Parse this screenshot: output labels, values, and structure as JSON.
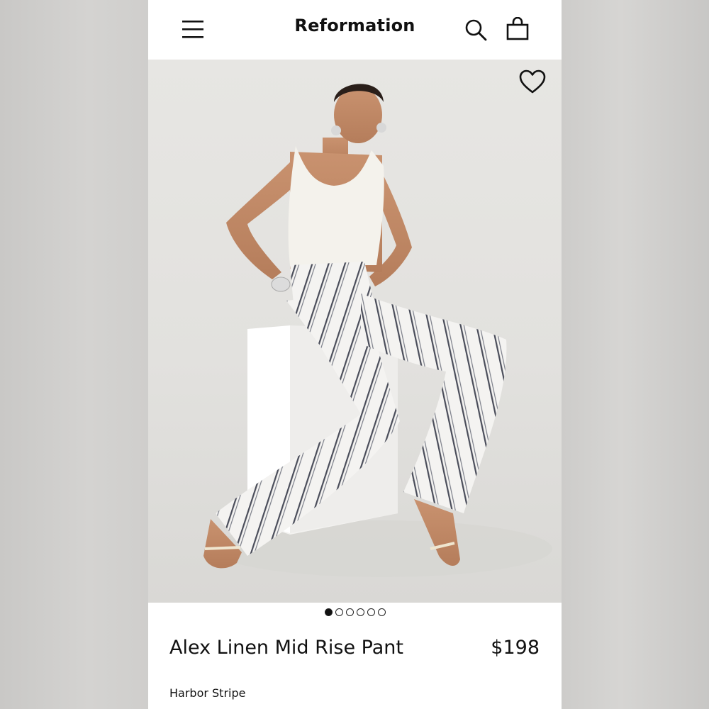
{
  "header": {
    "brand": "Reformation",
    "menu_icon": "hamburger-menu-icon",
    "search_icon": "search-icon",
    "bag_icon": "shopping-bag-icon"
  },
  "hero": {
    "wishlist_icon": "heart-outline-icon",
    "image_description_icon": "product-photo"
  },
  "carousel": {
    "total": 6,
    "active_index": 0
  },
  "product": {
    "name": "Alex Linen Mid Rise Pant",
    "price": "$198",
    "color": "Harbor Stripe"
  },
  "colors": {
    "text": "#111111",
    "page_background": "#ffffff",
    "photo_background": "#e4e3e0"
  }
}
